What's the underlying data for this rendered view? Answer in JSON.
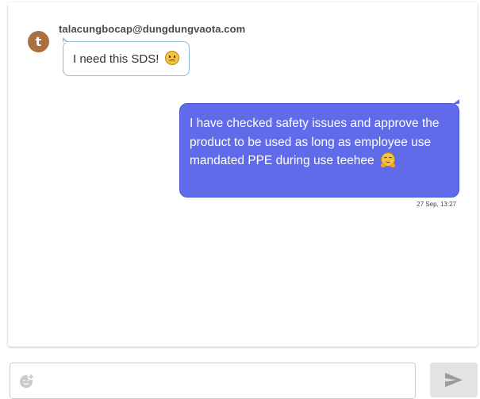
{
  "incoming_message": {
    "sender": "talacungbocap@dungdungvaota.com",
    "avatar_letter": "t",
    "text": "I need this SDS!",
    "emoji": "slightly-frowning-face-emoji"
  },
  "outgoing_message": {
    "text": "I have checked safety issues and approve the product to be used as long as employee use mandated PPE during use teehee",
    "emoji": "hugging-face-emoji",
    "timestamp": "27 Sep, 13:27"
  },
  "composer": {
    "placeholder": "",
    "value": "",
    "add_icon": "add-emoji-icon",
    "send_icon": "send-icon"
  },
  "colors": {
    "avatar": "#a9713e",
    "outgoing_bubble": "#5f6be9",
    "incoming_border": "#8fbad1",
    "send_button": "#e3e3e3"
  }
}
